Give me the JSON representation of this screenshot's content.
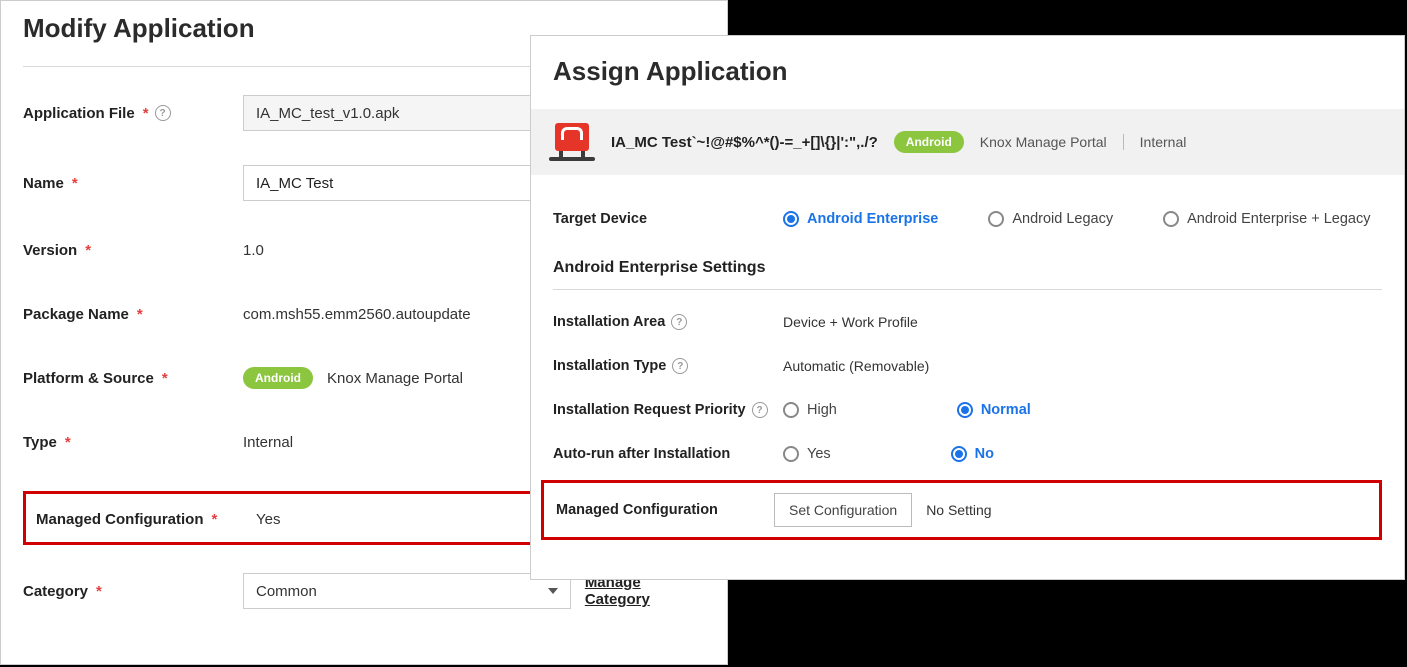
{
  "left": {
    "title": "Modify Application",
    "fields": {
      "appFile": {
        "label": "Application File",
        "value": "IA_MC_test_v1.0.apk"
      },
      "name": {
        "label": "Name",
        "value": "IA_MC Test"
      },
      "version": {
        "label": "Version",
        "value": "1.0"
      },
      "packageName": {
        "label": "Package Name",
        "value": "com.msh55.emm2560.autoupdate"
      },
      "platform": {
        "label": "Platform & Source",
        "badge": "Android",
        "value": "Knox Manage Portal"
      },
      "type": {
        "label": "Type",
        "value": "Internal"
      },
      "managedConfig": {
        "label": "Managed Configuration",
        "value": "Yes"
      },
      "category": {
        "label": "Category",
        "value": "Common",
        "manageLink": "Manage Category"
      }
    }
  },
  "right": {
    "title": "Assign Application",
    "info": {
      "appName": "IA_MC Test`~!@#$%^*()-=_+[]\\{}|':\",./?",
      "badge": "Android",
      "portal": "Knox Manage Portal",
      "type": "Internal"
    },
    "targetDevice": {
      "label": "Target Device",
      "options": [
        "Android Enterprise",
        "Android Legacy",
        "Android Enterprise + Legacy"
      ],
      "selected": "Android Enterprise"
    },
    "settingsHeading": "Android Enterprise Settings",
    "installationArea": {
      "label": "Installation Area",
      "value": "Device + Work Profile"
    },
    "installationType": {
      "label": "Installation Type",
      "value": "Automatic (Removable)"
    },
    "priority": {
      "label": "Installation Request Priority",
      "options": [
        "High",
        "Normal"
      ],
      "selected": "Normal"
    },
    "autorun": {
      "label": "Auto-run after Installation",
      "options": [
        "Yes",
        "No"
      ],
      "selected": "No"
    },
    "managedConfig": {
      "label": "Managed Configuration",
      "button": "Set Configuration",
      "status": "No Setting"
    }
  }
}
